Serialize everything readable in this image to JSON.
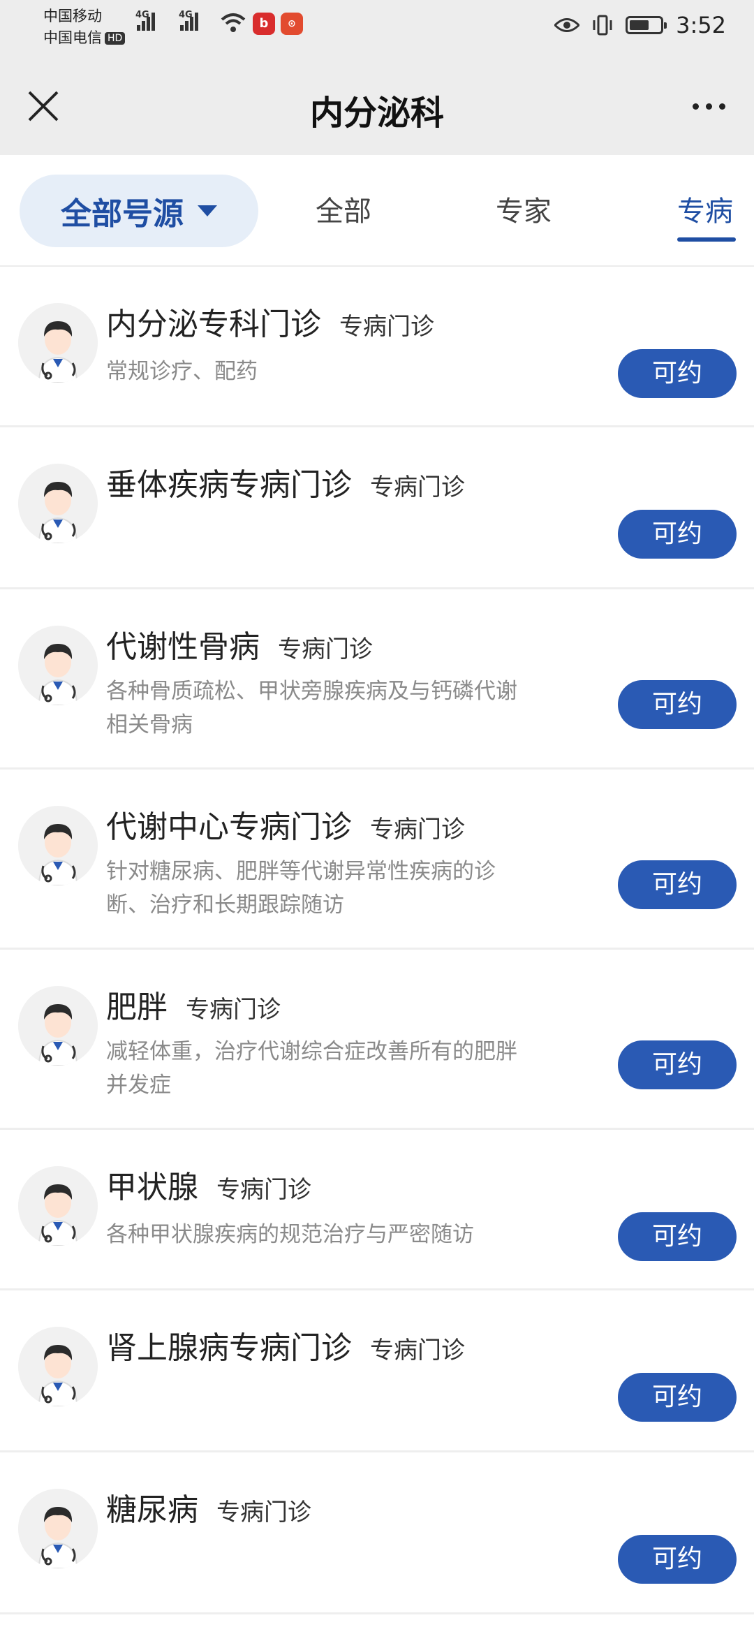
{
  "status_bar": {
    "carrier1": "中国移动",
    "carrier2": "中国电信",
    "hd_badge": "HD",
    "signal1_label": "4G",
    "signal2_label": "4G",
    "app1_icon": "b",
    "time": "3:52"
  },
  "header": {
    "title": "内分泌科"
  },
  "tabs": {
    "filter_label": "全部号源",
    "items": [
      {
        "label": "全部"
      },
      {
        "label": "专家"
      },
      {
        "label": "专病"
      }
    ]
  },
  "clinics": [
    {
      "name": "内分泌专科门诊",
      "tag": "专病门诊",
      "desc": "常规诊疗、配药",
      "button": "可约"
    },
    {
      "name": "垂体疾病专病门诊",
      "tag": "专病门诊",
      "desc": "",
      "button": "可约"
    },
    {
      "name": "代谢性骨病",
      "tag": "专病门诊",
      "desc": "各种骨质疏松、甲状旁腺疾病及与钙磷代谢相关骨病",
      "button": "可约"
    },
    {
      "name": "代谢中心专病门诊",
      "tag": "专病门诊",
      "desc": "针对糖尿病、肥胖等代谢异常性疾病的诊断、治疗和长期跟踪随访",
      "button": "可约"
    },
    {
      "name": "肥胖",
      "tag": "专病门诊",
      "desc": "减轻体重，治疗代谢综合症改善所有的肥胖并发症",
      "button": "可约"
    },
    {
      "name": "甲状腺",
      "tag": "专病门诊",
      "desc": "各种甲状腺疾病的规范治疗与严密随访",
      "button": "可约"
    },
    {
      "name": "肾上腺病专病门诊",
      "tag": "专病门诊",
      "desc": "",
      "button": "可约"
    },
    {
      "name": "糖尿病",
      "tag": "专病门诊",
      "desc": "",
      "button": "可约"
    }
  ],
  "colors": {
    "accent": "#2a5ab4",
    "filter_bg": "#e6eef8",
    "header_bg": "#ededed"
  },
  "icons": {
    "close": "close-icon",
    "more": "more-icon",
    "avatar": "doctor-avatar-icon"
  }
}
